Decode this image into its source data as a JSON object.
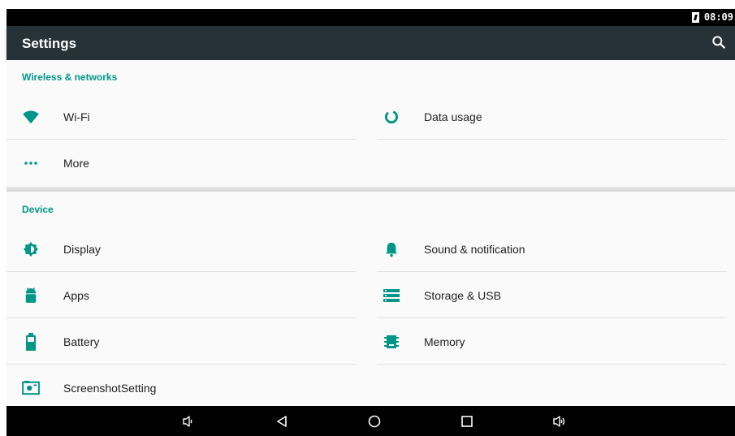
{
  "status_bar": {
    "time": "08:09",
    "icons": [
      "battery-charging-icon"
    ]
  },
  "app_bar": {
    "title": "Settings",
    "search_icon": "search-icon"
  },
  "sections": {
    "wireless": {
      "header": "Wireless & networks",
      "items": [
        {
          "label": "Wi-Fi",
          "icon": "wifi-icon"
        },
        {
          "label": "Data usage",
          "icon": "data-usage-icon"
        },
        {
          "label": "More",
          "icon": "more-dots-icon"
        }
      ]
    },
    "device": {
      "header": "Device",
      "items": [
        {
          "label": "Display",
          "icon": "display-brightness-icon"
        },
        {
          "label": "Sound & notification",
          "icon": "bell-icon"
        },
        {
          "label": "Apps",
          "icon": "android-icon"
        },
        {
          "label": "Storage & USB",
          "icon": "storage-icon"
        },
        {
          "label": "Battery",
          "icon": "battery-icon"
        },
        {
          "label": "Memory",
          "icon": "memory-chip-icon"
        },
        {
          "label": "ScreenshotSetting",
          "icon": "screenshot-icon"
        }
      ]
    }
  },
  "nav_bar": {
    "buttons": [
      "volume-down-icon",
      "back-icon",
      "home-icon",
      "recents-icon",
      "volume-up-icon"
    ]
  },
  "colors": {
    "accent": "#009688",
    "app_bar": "#263238",
    "status_bar": "#000000",
    "nav_bar": "#000000"
  }
}
